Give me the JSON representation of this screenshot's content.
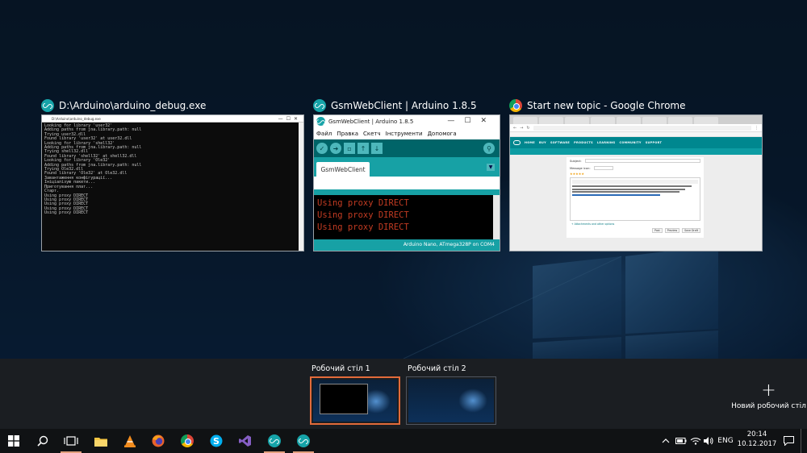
{
  "windows": [
    {
      "title": "D:\\Arduino\\arduino_debug.exe",
      "console_title": "D:\\Arduino\\arduino_debug.exe",
      "lines": [
        "Looking for library 'user32'",
        "Adding paths from jna.library.path: null",
        "Trying user32.dll",
        "Found library 'user32' at user32.dll",
        "Looking for library 'shell32'",
        "Adding paths from jna.library.path: null",
        "Trying shell32.dll",
        "Found library 'shell32' at shell32.dll",
        "Looking for library 'Ole32'",
        "Adding paths from jna.library.path: null",
        "Trying Ole32.dll",
        "Found library 'Ole32' at Ole32.dll",
        "Завантаження конфігурації...",
        "Ініціалізую пакети...",
        "Приготування плат...",
        "Старт.",
        "Using proxy DIRECT",
        "Using proxy DIRECT",
        "Using proxy DIRECT",
        "Using proxy DIRECT",
        "Using proxy DIRECT"
      ]
    },
    {
      "title": "GsmWebClient | Arduino 1.8.5",
      "window_title": "GsmWebClient | Arduino 1.8.5",
      "menu": [
        "Файл",
        "Правка",
        "Скетч",
        "Інструменти",
        "Допомога"
      ],
      "tab": "GsmWebClient",
      "console_lines": [
        "Using proxy DIRECT",
        "Using proxy DIRECT",
        "Using proxy DIRECT"
      ],
      "status": "Arduino Nano, ATmega328P on COM4"
    },
    {
      "title": "Start new topic - Google Chrome",
      "nav": [
        "HOME",
        "BUY",
        "SOFTWARE",
        "PRODUCTS",
        "LEARNING",
        "COMMUNITY",
        "SUPPORT"
      ],
      "subject_label": "Subject:",
      "icon_label": "Message icon:",
      "attach": "+ Attachments and other options",
      "buttons": [
        "Post",
        "Preview",
        "Save Draft"
      ]
    }
  ],
  "desktops": [
    {
      "label": "Робочий стіл 1",
      "active": true
    },
    {
      "label": "Робочий стіл 2",
      "active": false
    }
  ],
  "new_desktop_label": "Новий робочий стіл",
  "taskbar": {
    "icons": [
      "windows-start-icon",
      "search-icon",
      "task-view-icon",
      "file-explorer-icon",
      "vlc-icon",
      "firefox-icon",
      "chrome-icon",
      "skype-icon",
      "visual-studio-icon",
      "arduino-icon",
      "arduino-icon"
    ]
  },
  "tray": {
    "language": "ENG",
    "time": "20:14",
    "date": "10.12.2017"
  }
}
